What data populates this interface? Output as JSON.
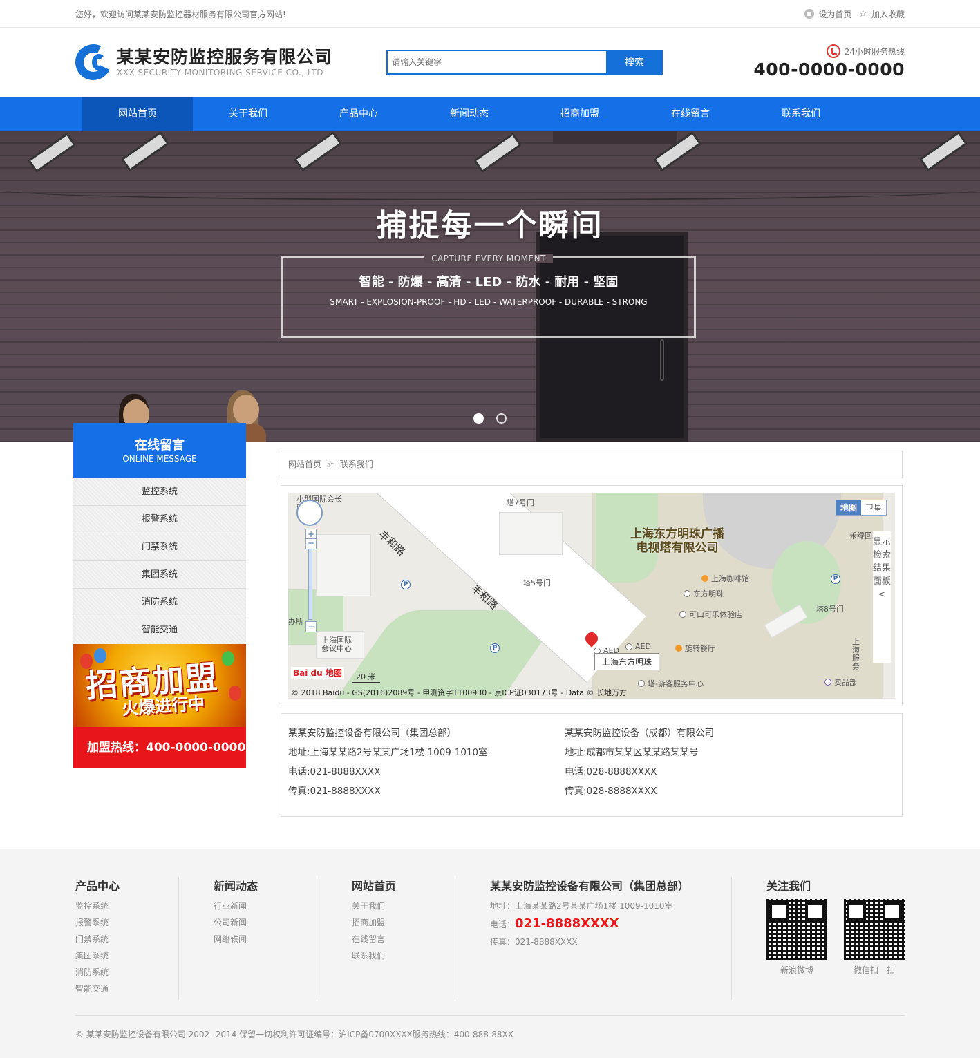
{
  "topbar": {
    "welcome": "您好，欢迎访问某某安防监控器材服务有限公司官方网站!",
    "set_home": "设为首页",
    "add_fav": "加入收藏"
  },
  "header": {
    "company_cn": "某某安防监控服务有限公司",
    "company_en": "XXX SECURITY MONITORING SERVICE CO., LTD",
    "search_placeholder": "请输入关键字",
    "search_button": "搜索",
    "hotline_label": "24小时服务热线",
    "hotline_number": "400-0000-0000"
  },
  "nav": [
    "网站首页",
    "关于我们",
    "产品中心",
    "新闻动态",
    "招商加盟",
    "在线留言",
    "联系我们"
  ],
  "banner": {
    "title": "捕捉每一个瞬间",
    "subtitle_en": "CAPTURE EVERY MOMENT",
    "features": "智能 - 防爆 - 高清 - LED - 防水 - 耐用 - 坚固",
    "features_en": "SMART - EXPLOSION-PROOF - HD - LED - WATERPROOF - DURABLE - STRONG"
  },
  "sidebar": {
    "title": "在线留言",
    "title_en": "ONLINE MESSAGE",
    "items": [
      "监控系统",
      "报警系统",
      "门禁系统",
      "集团系统",
      "消防系统",
      "智能交通"
    ],
    "promo_big": "招商加盟",
    "promo_sub": "火爆进行中",
    "promo_hotline": "加盟热线：400-0000-0000"
  },
  "breadcrumb": {
    "home": "网站首页",
    "sep": "☆",
    "current": "联系我们"
  },
  "map": {
    "main_label_1": "上海东方明珠广播",
    "main_label_2": "电视塔有限公司",
    "road_1": "丰和路",
    "road_2": "丰和路",
    "gate_7": "塔7号门",
    "gate_5": "塔5号门",
    "gate_8": "塔8号门",
    "poi_cafe": "上海咖啡馆",
    "poi_dfmz": "东方明珠",
    "poi_coke": "可口可乐体验店",
    "poi_aed1": "AED",
    "poi_aed2": "AED",
    "poi_rotate": "旋转餐厅",
    "poi_center": "塔-游客服务中心",
    "poi_shop": "卖品部",
    "poi_conf": "上海国际会议中心",
    "poi_expo": "小型国际会长廊",
    "poi_wood": "禾绿回转",
    "poi_side": "上海服务",
    "poi_left": "办所",
    "tip": "上海东方明珠",
    "type_map": "地图",
    "type_sat": "卫星",
    "panel": "显示检索结果面板<",
    "scale": "20 米",
    "logo": "Bai du 地图",
    "copyright": "© 2018 Baidu - GS(2016)2089号 - 甲测资字1100930 - 京ICP证030173号 - Data © 长地万方"
  },
  "addresses": [
    {
      "name": "某某安防监控设备有限公司（集团总部）",
      "address": "地址:上海某某路2号某某广场1楼 1009-1010室",
      "tel": "电话:021-8888XXXX",
      "fax": "传真:021-8888XXXX"
    },
    {
      "name": "某某安防监控设备（成都）有限公司",
      "address": "地址:成都市某某区某某路某某号",
      "tel": "电话:028-8888XXXX",
      "fax": "传真:028-8888XXXX"
    }
  ],
  "footer": {
    "col1": {
      "title": "产品中心",
      "links": [
        "监控系统",
        "报警系统",
        "门禁系统",
        "集团系统",
        "消防系统",
        "智能交通"
      ]
    },
    "col2": {
      "title": "新闻动态",
      "links": [
        "行业新闻",
        "公司新闻",
        "网络轶闻"
      ]
    },
    "col3": {
      "title": "网站首页",
      "links": [
        "关于我们",
        "招商加盟",
        "在线留言",
        "联系我们"
      ]
    },
    "col4": {
      "title": "某某安防监控设备有限公司（集团总部）",
      "address": "地址：上海某某路2号某某广场1楼 1009-1010室",
      "tel_label": "电话：",
      "tel": "021-8888XXXX",
      "fax": "传真：021-8888XXXX"
    },
    "col5": {
      "title": "关注我们",
      "qr1": "新浪微博",
      "qr2": "微信扫一扫"
    },
    "copyright": "© 某某安防监控设备有限公司 2002--2014 保留一切权利许可证编号：沪ICP备0700XXXX服务热线：400-888-88XX"
  },
  "colors": {
    "brand_blue": "#1570e8",
    "nav_active": "#0b56b8",
    "promo_red": "#e8151b"
  }
}
